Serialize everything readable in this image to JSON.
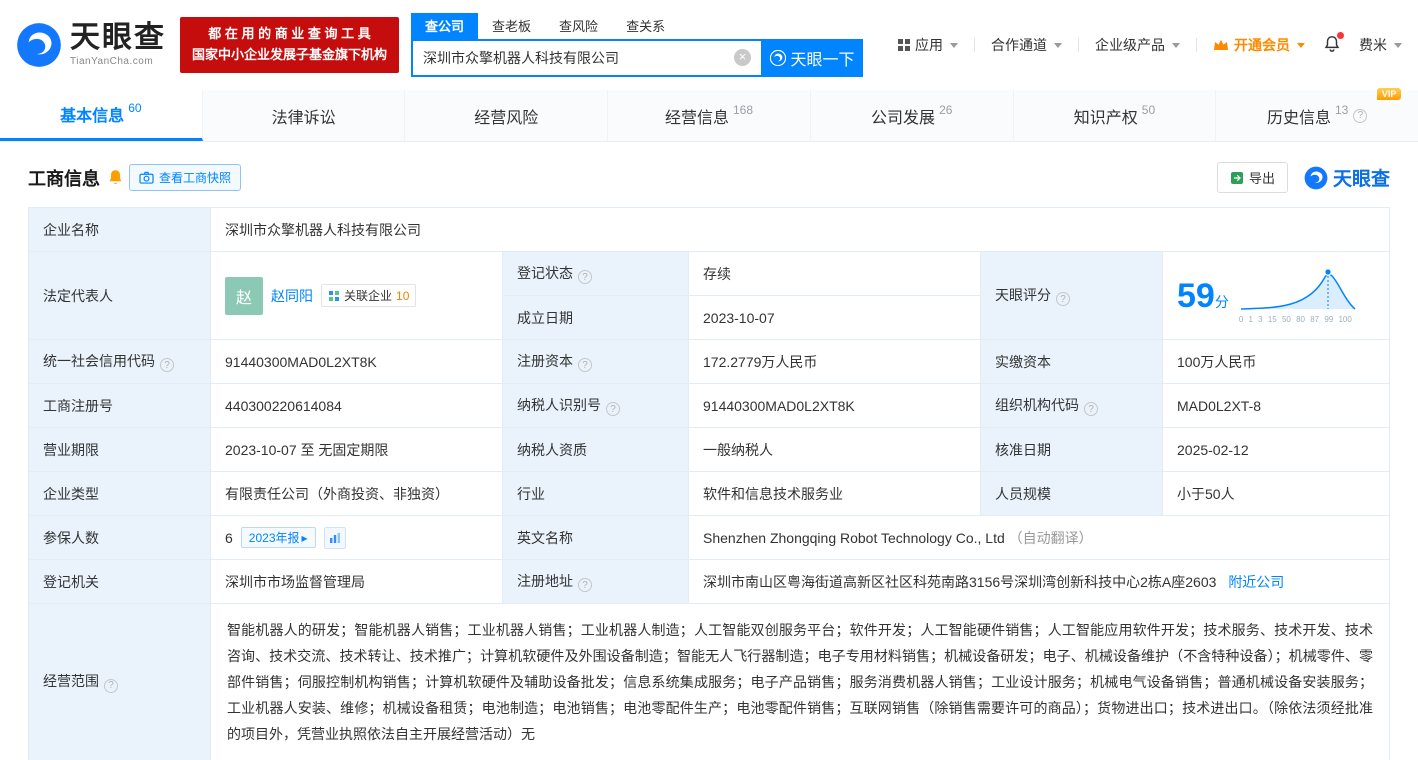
{
  "colors": {
    "accent": "#0084ff",
    "status_green": "#00a854",
    "vip_orange": "#ff8a00",
    "brand_red": "#c50d0d",
    "label_bg": "#eaf3fc"
  },
  "icons": {
    "help": "?",
    "clear": "×",
    "arrow_right": "▸"
  },
  "header": {
    "logo_title": "天眼查",
    "logo_sub": "TianYanCha.com",
    "slogan_line1": "都 在 用 的 商 业 查 询 工 具",
    "slogan_line2": "国家中小企业发展子基金旗下机构",
    "search_tabs": [
      {
        "label": "查公司"
      },
      {
        "label": "查老板"
      },
      {
        "label": "查风险"
      },
      {
        "label": "查关系"
      }
    ],
    "search_value": "深圳市众擎机器人科技有限公司",
    "search_button": "天眼一下",
    "nav": {
      "apps": "应用",
      "cooperation": "合作通道",
      "enterprise": "企业级产品",
      "vip": "开通会员",
      "user": "费米"
    }
  },
  "tabs": [
    {
      "label": "基本信息",
      "count": "60"
    },
    {
      "label": "法律诉讼",
      "count": ""
    },
    {
      "label": "经营风险",
      "count": ""
    },
    {
      "label": "经营信息",
      "count": "168"
    },
    {
      "label": "公司发展",
      "count": "26"
    },
    {
      "label": "知识产权",
      "count": "50"
    },
    {
      "label": "历史信息",
      "count": "13",
      "vip": "VIP"
    }
  ],
  "section": {
    "title": "工商信息",
    "snapshot_button": "查看工商快照",
    "export_button": "导出",
    "brand": "天眼查"
  },
  "info": {
    "company_name_label": "企业名称",
    "company_name": "深圳市众擎机器人科技有限公司",
    "legal_rep_label": "法定代表人",
    "legal_rep_avatar": "赵",
    "legal_rep_name": "赵同阳",
    "related_label": "关联企业",
    "related_count": "10",
    "reg_status_label": "登记状态",
    "reg_status": "存续",
    "establish_date_label": "成立日期",
    "establish_date": "2023-10-07",
    "score_label": "天眼评分",
    "score_value": "59",
    "score_unit": "分",
    "score_axis": "0 1 3 15 50 80 87 99 100",
    "credit_code_label": "统一社会信用代码",
    "credit_code": "91440300MAD0L2XT8K",
    "reg_capital_label": "注册资本",
    "reg_capital": "172.2779万人民币",
    "paid_capital_label": "实缴资本",
    "paid_capital": "100万人民币",
    "reg_number_label": "工商注册号",
    "reg_number": "440300220614084",
    "taxpayer_id_label": "纳税人识别号",
    "taxpayer_id": "91440300MAD0L2XT8K",
    "org_code_label": "组织机构代码",
    "org_code": "MAD0L2XT-8",
    "business_term_label": "营业期限",
    "business_term": "2023-10-07 至 无固定期限",
    "taxpayer_quality_label": "纳税人资质",
    "taxpayer_quality": "一般纳税人",
    "approval_date_label": "核准日期",
    "approval_date": "2025-02-12",
    "company_type_label": "企业类型",
    "company_type": "有限责任公司（外商投资、非独资）",
    "industry_label": "行业",
    "industry": "软件和信息技术服务业",
    "staff_size_label": "人员规模",
    "staff_size": "小于50人",
    "insured_label": "参保人数",
    "insured_count": "6",
    "annual_report": "2023年报",
    "english_name_label": "英文名称",
    "english_name": "Shenzhen Zhongqing Robot Technology Co., Ltd",
    "english_name_note": "（自动翻译）",
    "reg_authority_label": "登记机关",
    "reg_authority": "深圳市市场监督管理局",
    "address_label": "注册地址",
    "address": "深圳市南山区粤海街道高新区社区科苑南路3156号深圳湾创新科技中心2栋A座2603",
    "nearby_link": "附近公司",
    "scope_label": "经营范围",
    "scope": "智能机器人的研发；智能机器人销售；工业机器人销售；工业机器人制造；人工智能双创服务平台；软件开发；人工智能硬件销售；人工智能应用软件开发；技术服务、技术开发、技术咨询、技术交流、技术转让、技术推广；计算机软硬件及外围设备制造；智能无人飞行器制造；电子专用材料销售；机械设备研发；电子、机械设备维护（不含特种设备）；机械零件、零部件销售；伺服控制机构销售；计算机软硬件及辅助设备批发；信息系统集成服务；电子产品销售；服务消费机器人销售；工业设计服务；机械电气设备销售；普通机械设备安装服务；工业机器人安装、维修；机械设备租赁；电池制造；电池销售；电池零配件生产；电池零配件销售；互联网销售（除销售需要许可的商品）；货物进出口；技术进出口。（除依法须经批准的项目外，凭营业执照依法自主开展经营活动）无"
  }
}
